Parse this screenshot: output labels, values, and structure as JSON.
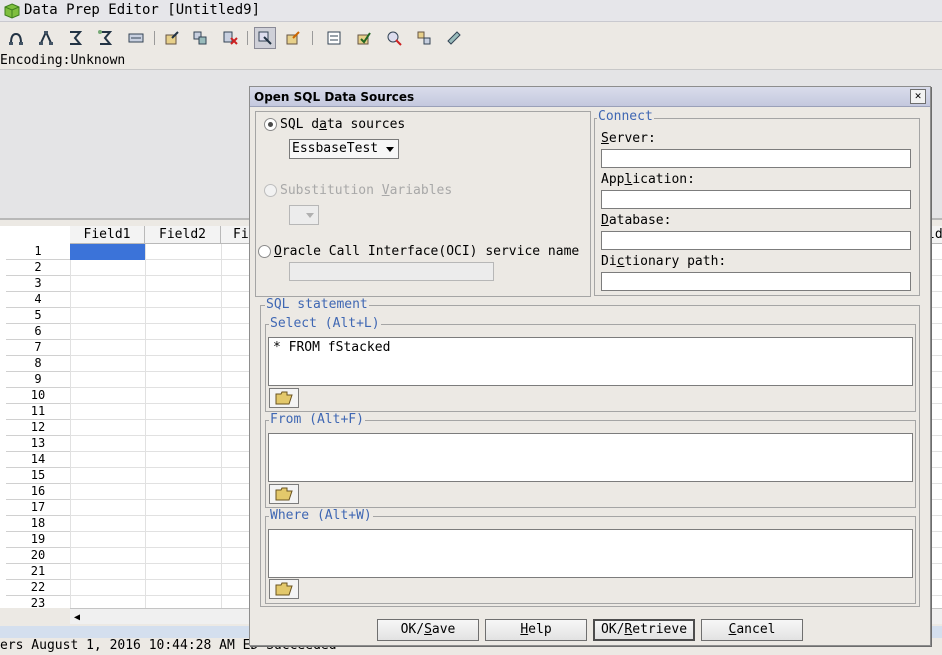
{
  "window": {
    "title": "Data Prep Editor [Untitled9]",
    "encoding_label": "Encoding:Unknown"
  },
  "toolbar": {
    "icons": [
      "open-data-icon",
      "open-rules-icon",
      "sort-ascending-icon",
      "sort-descending-icon",
      "record-view-icon",
      "open-sql-icon",
      "associate-outline-icon",
      "clear-icon",
      "data-source-icon",
      "dimension-build-icon",
      "field-properties-icon",
      "validate-icon",
      "data-load-icon",
      "dimension-icon",
      "replace-icon"
    ]
  },
  "grid": {
    "columns": [
      "Field1",
      "Field2",
      "Fi",
      "ld"
    ],
    "rows": [
      "1",
      "2",
      "3",
      "4",
      "5",
      "6",
      "7",
      "8",
      "9",
      "10",
      "11",
      "12",
      "13",
      "14",
      "15",
      "16",
      "17",
      "18",
      "19",
      "20",
      "21",
      "22",
      "23"
    ]
  },
  "status_bar": {
    "text": "ers August 1, 2016 10:44:28 AM ED  Succeeded"
  },
  "dialog": {
    "title": "Open SQL Data Sources",
    "close_glyph": "✕",
    "sql_data_sources": {
      "label_pre": "SQL d",
      "label_underlined": "a",
      "label_post": "ta sources",
      "selected": true,
      "value": "EssbaseTest"
    },
    "substitution_variables": {
      "label_pre": "Substitution ",
      "label_underlined": "V",
      "label_post": "ariables",
      "enabled": false,
      "value": ""
    },
    "oci": {
      "label_underlined": "O",
      "label_post": "racle Call Interface(OCI) service name",
      "value": ""
    },
    "connect": {
      "legend": "Connect",
      "server": {
        "label_underlined": "S",
        "label_post": "erver:",
        "value": ""
      },
      "application": {
        "label_pre": "App",
        "label_underlined": "l",
        "label_post": "ication:",
        "value": ""
      },
      "database": {
        "label_underlined": "D",
        "label_post": "atabase:",
        "value": ""
      },
      "dictionary_path": {
        "label_pre": "Di",
        "label_underlined": "c",
        "label_post": "tionary path:",
        "value": ""
      }
    },
    "sql_statement": {
      "legend": "SQL statement",
      "select": {
        "legend": "Select (Alt+L)",
        "value": "* FROM fStacked"
      },
      "from": {
        "legend": "From (Alt+F)",
        "value": ""
      },
      "where": {
        "legend": "Where (Alt+W)",
        "value": ""
      }
    },
    "buttons": {
      "ok_save": {
        "pre": "OK/",
        "u": "S",
        "post": "ave"
      },
      "help": {
        "pre": "",
        "u": "H",
        "post": "elp"
      },
      "ok_retrieve": {
        "pre": "OK/",
        "u": "R",
        "post": "etrieve"
      },
      "cancel": {
        "pre": "",
        "u": "C",
        "post": "ancel"
      }
    }
  },
  "colors": {
    "selection": "#3b73d9",
    "legend_text": "#3f67b3",
    "status_strip": "#d4dfee"
  }
}
